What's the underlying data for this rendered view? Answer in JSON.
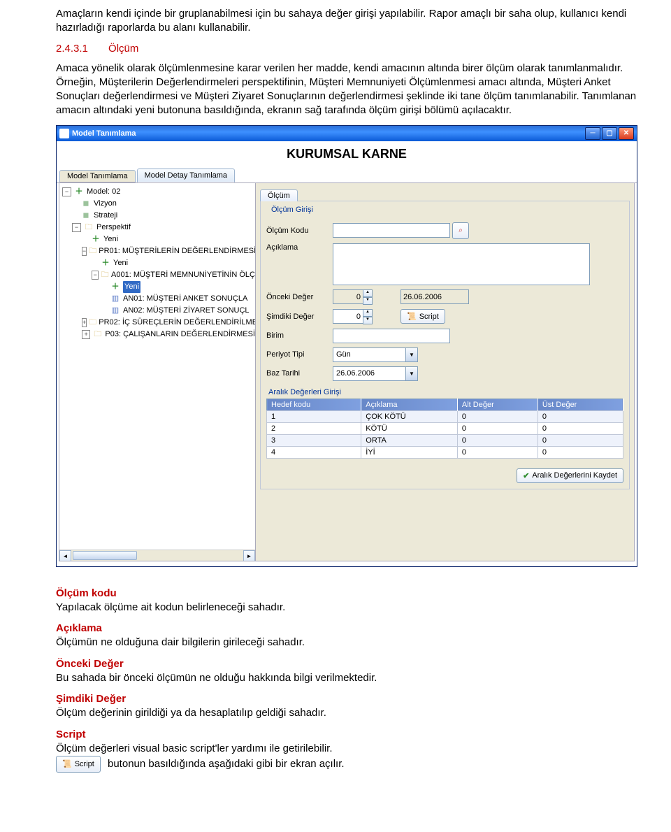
{
  "doc": {
    "p1": "Amaçların kendi içinde bir gruplanabilmesi için bu sahaya değer girişi yapılabilir. Rapor amaçlı bir saha olup, kullanıcı kendi hazırladığı raporlarda bu alanı kullanabilir.",
    "sec_num": "2.4.3.1",
    "sec_title": "Ölçüm",
    "p2": "Amaca yönelik olarak ölçümlenmesine karar verilen her madde, kendi amacının altında birer ölçüm olarak tanımlanmalıdır. Örneğin, Müşterilerin Değerlendirmeleri perspektifinin, Müşteri Memnuniyeti Ölçümlenmesi amacı altında, Müşteri Anket Sonuçları değerlendirmesi ve Müşteri Ziyaret Sonuçlarının değerlendirmesi şeklinde iki tane ölçüm tanımlanabilir. Tanımlanan amacın altındaki yeni butonuna basıldığında, ekranın sağ tarafında ölçüm girişi bölümü açılacaktır.",
    "defs": {
      "t1": "Ölçüm kodu",
      "d1": "Yapılacak ölçüme ait kodun belirleneceği sahadır.",
      "t2": "Açıklama",
      "d2": "Ölçümün ne olduğuna dair bilgilerin girileceği sahadır.",
      "t3": "Önceki Değer",
      "d3": "Bu sahada bir önceki ölçümün ne olduğu hakkında bilgi verilmektedir.",
      "t4": "Şimdiki Değer",
      "d4": "Ölçüm değerinin girildiği ya da hesaplatılıp geldiği sahadır.",
      "t5": "Script",
      "d5": "Ölçüm değerleri visual basic script'ler yardımı ile getirilebilir.",
      "d6_suffix": "butonun basıldığında aşağıdaki gibi bir ekran açılır."
    }
  },
  "app": {
    "window_title": "Model Tanımlama",
    "banner": "KURUMSAL KARNE",
    "tabs": {
      "t1": "Model Tanımlama",
      "t2": "Model Detay Tanımlama"
    },
    "tree": {
      "n0": "Model: 02",
      "n1": "Vizyon",
      "n2": "Strateji",
      "n3": "Perspektif",
      "n4": "Yeni",
      "n5": "PR01: MÜŞTERİLERİN DEĞERLENDİRMESİ",
      "n6": "Yeni",
      "n7": "A001: MÜŞTERİ MEMNUNİYETİNİN ÖLÇ",
      "n8": "Yeni",
      "n9": "AN01: MÜŞTERİ ANKET SONUÇLA",
      "n10": "AN02: MÜŞTERİ ZİYARET SONUÇL",
      "n11": "PR02: İÇ SÜREÇLERİN DEĞERLENDİRİLME",
      "n12": "P03: ÇALIŞANLARIN DEĞERLENDİRMESİ"
    },
    "right": {
      "tab": "Ölçüm",
      "legend1": "Ölçüm Girişi",
      "lbl_code": "Ölçüm Kodu",
      "lbl_desc": "Açıklama",
      "lbl_prev": "Önceki Değer",
      "prev_val": "0",
      "prev_date": "26.06.2006",
      "lbl_cur": "Şimdiki Değer",
      "cur_val": "0",
      "btn_script": "Script",
      "lbl_unit": "Birim",
      "lbl_period": "Periyot Tipi",
      "period_val": "Gün",
      "lbl_base": "Baz Tarihi",
      "base_date": "26.06.2006",
      "legend2": "Aralık Değerleri Girişi",
      "cols": {
        "c1": "Hedef kodu",
        "c2": "Açıklama",
        "c3": "Alt Değer",
        "c4": "Üst Değer"
      },
      "rows": [
        {
          "k": "1",
          "a": "ÇOK KÖTÜ",
          "l": "0",
          "u": "0"
        },
        {
          "k": "2",
          "a": "KÖTÜ",
          "l": "0",
          "u": "0"
        },
        {
          "k": "3",
          "a": "ORTA",
          "l": "0",
          "u": "0"
        },
        {
          "k": "4",
          "a": "İYİ",
          "l": "0",
          "u": "0"
        }
      ],
      "btn_save": "Aralık Değerlerini Kaydet"
    }
  }
}
